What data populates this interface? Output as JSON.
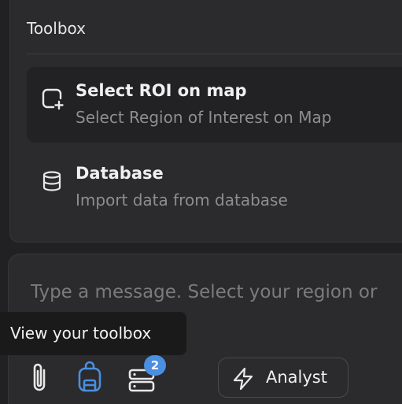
{
  "toolbox": {
    "title": "Toolbox",
    "items": [
      {
        "name": "Select ROI on map",
        "description": "Select Region of Interest on Map",
        "icon": "square-plus-icon"
      },
      {
        "name": "Database",
        "description": "Import data from database",
        "icon": "database-icon"
      }
    ]
  },
  "composer": {
    "placeholder": "Type a message. Select your region or",
    "tooltip": "View your toolbox",
    "toolbox_badge": "2",
    "mode_label": "Analyst",
    "icons": [
      "paperclip-icon",
      "backpack-icon",
      "server-icon",
      "lightning-icon"
    ]
  },
  "colors": {
    "accent": "#4a8fe0",
    "panel": "#2b2b2d",
    "background": "#212123"
  }
}
